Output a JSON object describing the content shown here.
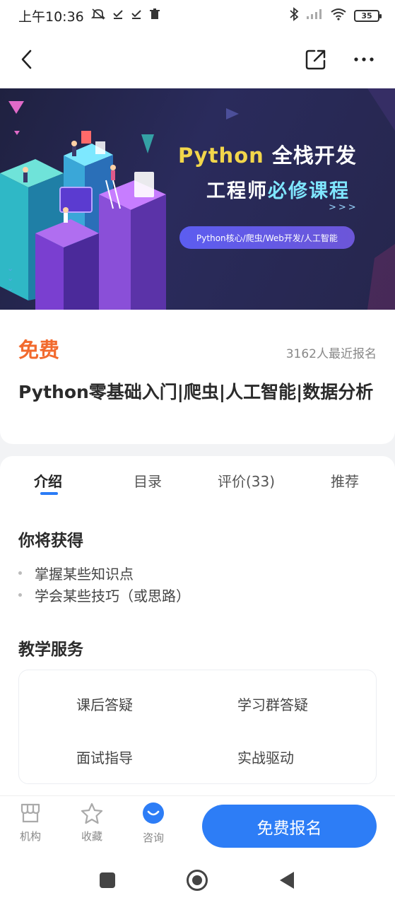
{
  "status": {
    "time": "上午10:36",
    "battery": "35"
  },
  "banner": {
    "title_python": "Python",
    "title_rest": " 全栈开发",
    "subtitle_a": "工程师",
    "subtitle_b": "必修课程",
    "arrows": ">>>",
    "pill": "Python核心/爬虫/Web开发/人工智能"
  },
  "course": {
    "price": "免费",
    "enroll_count": "3162人最近报名",
    "title": "Python零基础入门|爬虫|人工智能|数据分析"
  },
  "tabs": [
    {
      "label": "介绍"
    },
    {
      "label": "目录"
    },
    {
      "label": "评价(33)"
    },
    {
      "label": "推荐"
    }
  ],
  "gain": {
    "title": "你将获得",
    "items": [
      "掌握某些知识点",
      "学会某些技巧（或思路）"
    ]
  },
  "services": {
    "title": "教学服务",
    "items": [
      "课后答疑",
      "学习群答疑",
      "面试指导",
      "实战驱动"
    ]
  },
  "action_bar": {
    "org_label": "机构",
    "fav_label": "收藏",
    "consult_label": "咨询",
    "enroll_label": "免费报名"
  },
  "colors": {
    "accent_blue": "#2d7df6",
    "price_orange": "#f26a2e"
  }
}
